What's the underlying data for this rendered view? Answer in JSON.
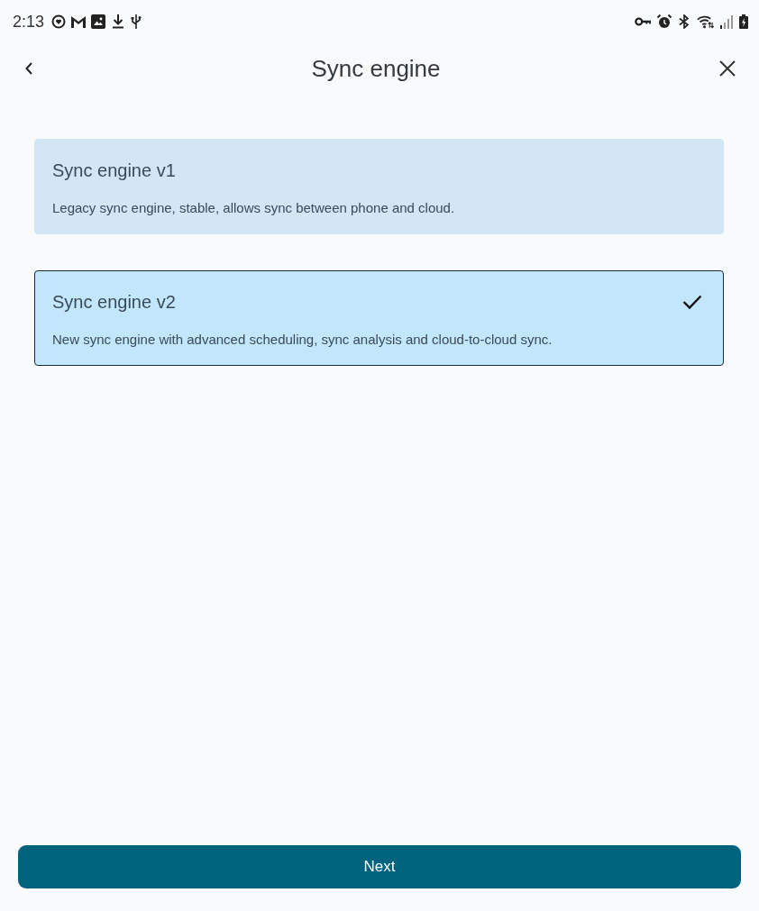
{
  "status_bar": {
    "time": "2:13"
  },
  "header": {
    "title": "Sync engine"
  },
  "options": [
    {
      "title": "Sync engine v1",
      "description": "Legacy sync engine, stable, allows sync between phone and cloud.",
      "selected": false
    },
    {
      "title": "Sync engine v2",
      "description": "New sync engine with advanced scheduling, sync analysis and cloud-to-cloud sync.",
      "selected": true
    }
  ],
  "footer": {
    "button": "Next"
  }
}
